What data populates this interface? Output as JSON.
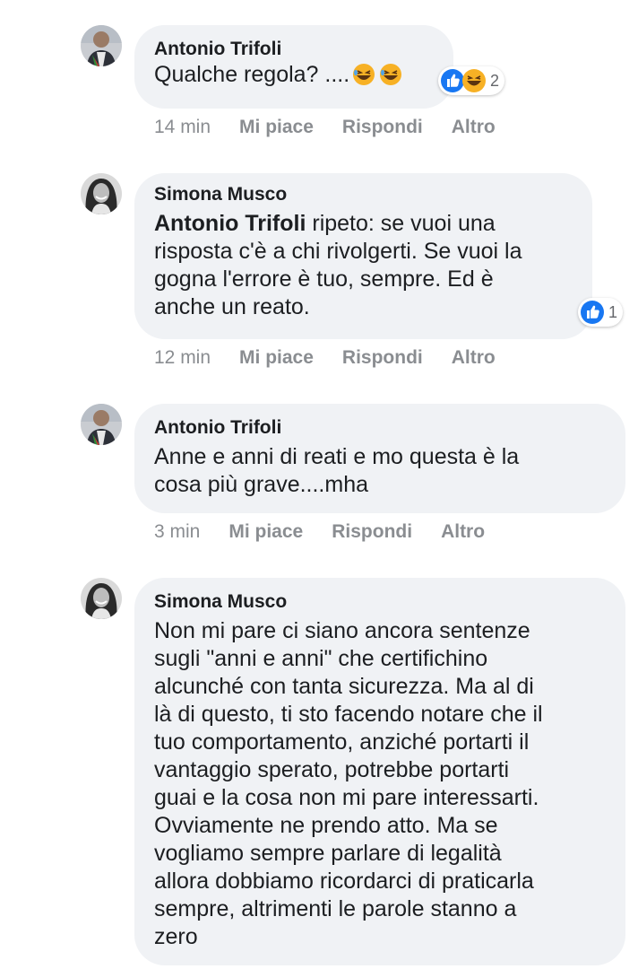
{
  "comments": [
    {
      "author": "Antonio Trifoli",
      "text": "Qualche regola? ....",
      "time": "14 min",
      "like": "Mi piace",
      "reply": "Rispondi",
      "more": "Altro",
      "reaction_count": "2"
    },
    {
      "author": "Simona Musco",
      "mention": "Antonio Trifoli",
      "text": " ripeto: se vuoi una\nrisposta c'è a chi rivolgerti. Se vuoi la\ngogna l'errore è tuo, sempre. Ed è\nanche un reato.",
      "time": "12 min",
      "like": "Mi piace",
      "reply": "Rispondi",
      "more": "Altro",
      "reaction_count": "1"
    },
    {
      "author": "Antonio Trifoli",
      "text": "Anne e anni di reati e mo questa è la\ncosa più grave....mha",
      "time": "3 min",
      "like": "Mi piace",
      "reply": "Rispondi",
      "more": "Altro"
    },
    {
      "author": "Simona Musco",
      "text": "Non mi pare ci siano ancora sentenze\nsugli \"anni e anni\" che certifichino\nalcunché con tanta sicurezza. Ma al di\nlà di questo, ti sto facendo notare che il\ntuo comportamento, anziché portarti il\nvantaggio sperato, potrebbe portarti\nguai e la cosa non mi pare interessarti.\nOvviamente ne prendo atto. Ma se\nvogliamo sempre parlare di legalità\nallora dobbiamo ricordarci di praticarla\nsempre, altrimenti le parole stanno a\nzero"
    }
  ],
  "colors": {
    "bubble": "#f0f2f5",
    "meta_text": "#8a8d91",
    "like_blue": "#1877f2",
    "haha_yellow": "#f7b125"
  },
  "icons": {
    "laugh": "laughing-emoji-icon",
    "like": "like-reaction-icon",
    "haha": "haha-reaction-icon"
  }
}
